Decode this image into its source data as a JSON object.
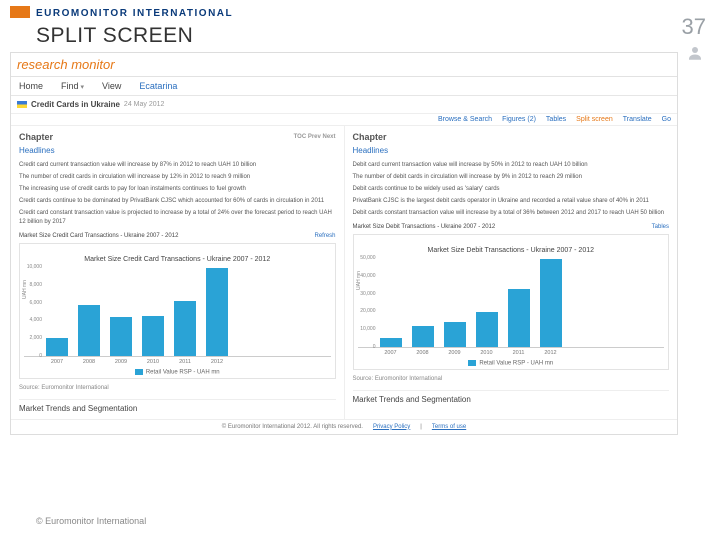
{
  "slide": {
    "brand": "EUROMONITOR INTERNATIONAL",
    "title": "SPLIT SCREEN",
    "page_number": "37",
    "bottom_credit": "© Euromonitor International"
  },
  "app": {
    "logo_text": "research monitor",
    "nav": {
      "home": "Home",
      "find": "Find",
      "view": "View",
      "ecatarina": "Ecatarina"
    },
    "breadcrumb": {
      "title": "Credit Cards in Ukraine",
      "date": "24 May 2012"
    },
    "tools": {
      "browse": "Browse & Search",
      "figures": "Figures (2)",
      "tables": "Tables",
      "split": "Split screen",
      "translate": "Translate",
      "go": "Go"
    },
    "footer": {
      "copyright": "© Euromonitor International 2012. All rights reserved.",
      "privacy": "Privacy Policy",
      "terms": "Terms of use"
    }
  },
  "left": {
    "chapter": "Chapter",
    "toc": "TOC  Prev  Next",
    "headlines": "Headlines",
    "bullets": [
      "Credit card current transaction value will increase by 87% in 2012 to reach UAH 10 billion",
      "The number of credit cards in circulation will increase by 12% in 2012 to reach 9 million",
      "The increasing use of credit cards to pay for loan instalments continues to fuel growth",
      "Credit cards continue to be dominated by PrivatBank CJSC which accounted for 60% of cards in circulation in 2011",
      "Credit card constant transaction value is projected to increase by a total of 24% over the forecast period to reach UAH 12 billion by 2017"
    ],
    "chart_header": "Market Size Credit Card Transactions - Ukraine 2007 - 2012",
    "chart_title": "Market Size Credit Card Transactions - Ukraine 2007 - 2012",
    "refresh": "Refresh",
    "legend": "Retail Value RSP - UAH mn",
    "source": "Source: Euromonitor International",
    "section": "Market Trends and Segmentation"
  },
  "right": {
    "chapter": "Chapter",
    "headlines": "Headlines",
    "bullets": [
      "Debit card current transaction value will increase by 50% in 2012 to reach UAH 10 billion",
      "The number of debit cards in circulation will increase by 9% in 2012 to reach 29 million",
      "Debit cards continue to be widely used as 'salary' cards",
      "PrivatBank CJSC is the largest debit cards operator in Ukraine and recorded a retail value share of 40% in 2011",
      "Debit cards constant transaction value will increase by a total of 36% between 2012 and 2017 to reach UAH 50 billion"
    ],
    "chart_header": "Market Size Debit Transactions - Ukraine 2007 - 2012",
    "chart_title": "Market Size Debit Transactions - Ukraine 2007 - 2012",
    "tables_link": "Tables",
    "legend": "Retail Value RSP - UAH mn",
    "source": "Source: Euromonitor International",
    "section": "Market Trends and Segmentation"
  },
  "chart_data": [
    {
      "type": "bar",
      "title": "Market Size Credit Card Transactions - Ukraine 2007 - 2012",
      "categories": [
        "2007",
        "2008",
        "2009",
        "2010",
        "2011",
        "2012"
      ],
      "values": [
        2000,
        5800,
        4400,
        4600,
        6200,
        10000
      ],
      "ylabel": "UAH mn",
      "xlabel": "",
      "ylim": [
        0,
        10000
      ],
      "legend": "Retail Value RSP - UAH mn"
    },
    {
      "type": "bar",
      "title": "Market Size Debit Transactions - Ukraine 2007 - 2012",
      "categories": [
        "2007",
        "2008",
        "2009",
        "2010",
        "2011",
        "2012"
      ],
      "values": [
        5000,
        12000,
        14000,
        20000,
        33000,
        50000
      ],
      "ylabel": "UAH mn",
      "xlabel": "",
      "ylim": [
        0,
        50000
      ],
      "legend": "Retail Value RSP - UAH mn"
    }
  ]
}
